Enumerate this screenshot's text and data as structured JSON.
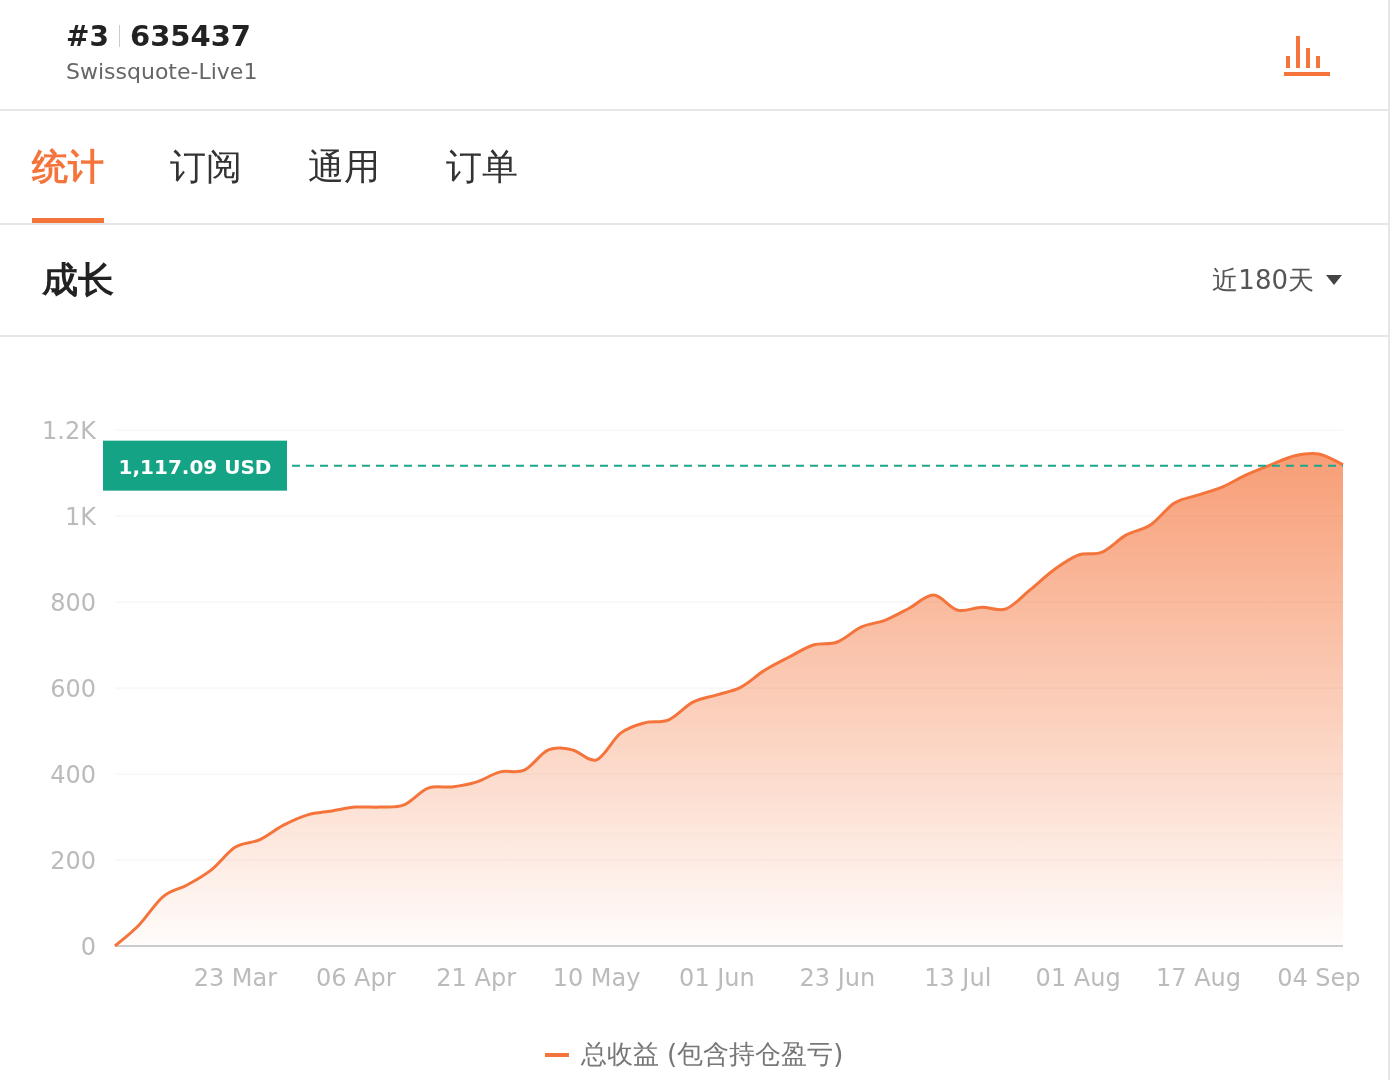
{
  "header": {
    "rank": "#3",
    "account": "635437",
    "server": "Swissquote-Live1"
  },
  "tabs": [
    {
      "label": "统计",
      "selected": true
    },
    {
      "label": "订阅",
      "selected": false
    },
    {
      "label": "通用",
      "selected": false
    },
    {
      "label": "订单",
      "selected": false
    }
  ],
  "section": {
    "title": "成长",
    "range": "近180天",
    "chart_data": {
      "type": "area",
      "ylim": [
        0,
        1200
      ],
      "categories": [
        null,
        null,
        null,
        null,
        null,
        "23 Mar",
        null,
        null,
        null,
        null,
        "06 Apr",
        null,
        null,
        null,
        null,
        "21 Apr",
        null,
        null,
        null,
        null,
        "10 May",
        null,
        null,
        null,
        null,
        "01 Jun",
        null,
        null,
        null,
        null,
        "23 Jun",
        null,
        null,
        null,
        null,
        "13 Jul",
        null,
        null,
        null,
        null,
        "01 Aug",
        null,
        null,
        null,
        null,
        "17 Aug",
        null,
        null,
        null,
        null,
        "04 Sep",
        null
      ],
      "yticks": [
        0,
        200,
        400,
        600,
        800,
        {
          "value": 1000,
          "label": "1K"
        },
        {
          "value": 1200,
          "label": "1.2K"
        }
      ],
      "series": [
        {
          "name": "总收益 (包含持仓盈亏)",
          "color": "#f4743b",
          "values": [
            0,
            49,
            115,
            142,
            177,
            230,
            247,
            281,
            305,
            314,
            323,
            323,
            328,
            367,
            370,
            381,
            405,
            409,
            456,
            456,
            433,
            495,
            519,
            526,
            567,
            584,
            602,
            642,
            672,
            700,
            707,
            742,
            758,
            786,
            816,
            781,
            788,
            784,
            828,
            875,
            909,
            916,
            956,
            979,
            1030,
            1049,
            1068,
            1096,
            1119,
            1140,
            1144,
            1119
          ]
        }
      ],
      "grid": true,
      "ref_lines": [
        {
          "axis": "y",
          "value": 1117.09,
          "label": "1,117.09 USD"
        }
      ]
    }
  }
}
